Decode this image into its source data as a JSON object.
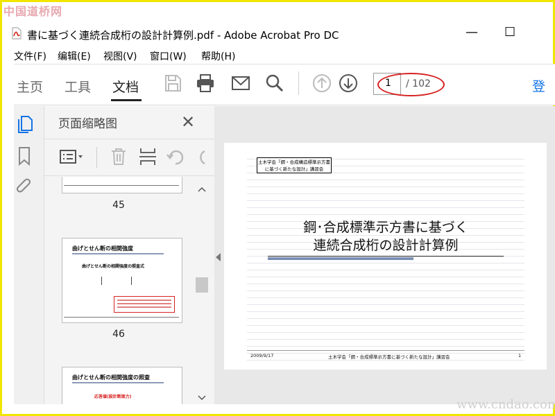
{
  "watermark_top": "中国道桥网",
  "watermark_bottom": "www.cndao.com",
  "window": {
    "title": "書に基づく連続合成桁の設計計算例.pdf - Adobe Acrobat Pro DC",
    "minimize": "—",
    "maximize": "☐"
  },
  "menu": [
    "文件(F)",
    "编辑(E)",
    "视图(V)",
    "窗口(W)",
    "帮助(H)"
  ],
  "tabs": [
    "主页",
    "工具",
    "文档"
  ],
  "active_tab": "文档",
  "toolbar": {
    "page_current": "1",
    "page_total": "/ 102",
    "login": "登"
  },
  "panel": {
    "title": "页面缩略图",
    "close": "✕"
  },
  "thumbnails": [
    {
      "label": "45"
    },
    {
      "label": "46",
      "title": "曲げとせん断の相関強度",
      "subtitle": "曲げとせん断の相関強度の照査式"
    },
    {
      "label": "",
      "title": "曲げとせん断の相関強度の照査",
      "subtitle": "応答値(設計断面力)"
    }
  ],
  "slide": {
    "header_line1": "土木学会「鋼・合成構造標準示方書",
    "header_line2": "に基づく新たな設計」講習会",
    "title_line1": "鋼･合成標準示方書に基づく",
    "title_line2": "連続合成桁の設計計算例",
    "footer_date": "2009/9/17",
    "footer_center": "土木学会「鋼・合成標準示方書に基づく新たな設計」講習会",
    "footer_page": "1"
  },
  "colors": {
    "accent": "#1473e6",
    "annotation": "#d72020",
    "border": "#f2e600"
  }
}
